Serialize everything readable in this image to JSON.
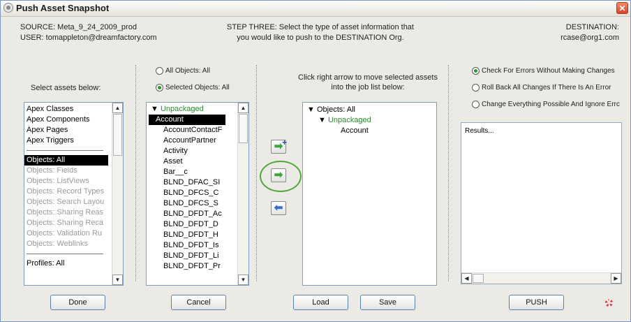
{
  "window": {
    "title": "Push Asset Snapshot",
    "close_glyph": "✕"
  },
  "header": {
    "source_line": "SOURCE: Meta_9_24_2009_prod",
    "user_line": "USER: tomappleton@dreamfactory.com",
    "step_line1": "STEP THREE: Select the type of asset information that",
    "step_line2": "you would like to push to the DESTINATION Org.",
    "dest_line1": "DESTINATION:",
    "dest_line2": "rcase@org1.com"
  },
  "assets_panel": {
    "label": "Select assets below:",
    "items_top": [
      "Apex Classes",
      "Apex Components",
      "Apex Pages",
      "Apex Triggers"
    ],
    "items_selected": "Objects: All",
    "items_dim": [
      "Objects: Fields",
      "Objects: ListViews",
      "Objects: Record Types",
      "Objects: Search Layou",
      "Objects: Sharing Reas",
      "Objects: Sharing Reca",
      "Objects: Validation Ru",
      "Objects: Weblinks"
    ],
    "items_bottom": [
      "Profiles: All"
    ]
  },
  "objects_panel": {
    "radio_all": "All Objects: All",
    "radio_selected": "Selected Objects: All",
    "root": "Unpackaged",
    "selected_item": "Account",
    "items": [
      "AccountContactF",
      "AccountPartner",
      "Activity",
      "Asset",
      "Bar__c",
      "BLND_DFAC_SI",
      "BLND_DFCS_C",
      "BLND_DFCS_S",
      "BLND_DFDT_Ac",
      "BLND_DFDT_D",
      "BLND_DFDT_H",
      "BLND_DFDT_Is",
      "BLND_DFDT_Li",
      "BLND_DFDT_Pr"
    ]
  },
  "move_buttons": {
    "add_all_glyph": "➡",
    "plus_glyph": "+",
    "add_glyph": "➡",
    "remove_glyph": "⬅"
  },
  "joblist_panel": {
    "label_line1": "Click right arrow to move selected assets",
    "label_line2": "into the job list below:",
    "root": "Objects: All",
    "child": "Unpackaged",
    "leaf": "Account"
  },
  "options_panel": {
    "radio_check": "Check For Errors Without Making Changes",
    "radio_rollback": "Roll Back All Changes If There Is An Error",
    "radio_change": "Change Everything Possible And Ignore Errc",
    "results_text": "Results..."
  },
  "buttons": {
    "done": "Done",
    "cancel": "Cancel",
    "load": "Load",
    "save": "Save",
    "push": "PUSH"
  },
  "colors": {
    "selected_radio": "#2a9a2a",
    "highlight_circle": "#4fa83c",
    "tree_green": "#2a8a2a"
  }
}
